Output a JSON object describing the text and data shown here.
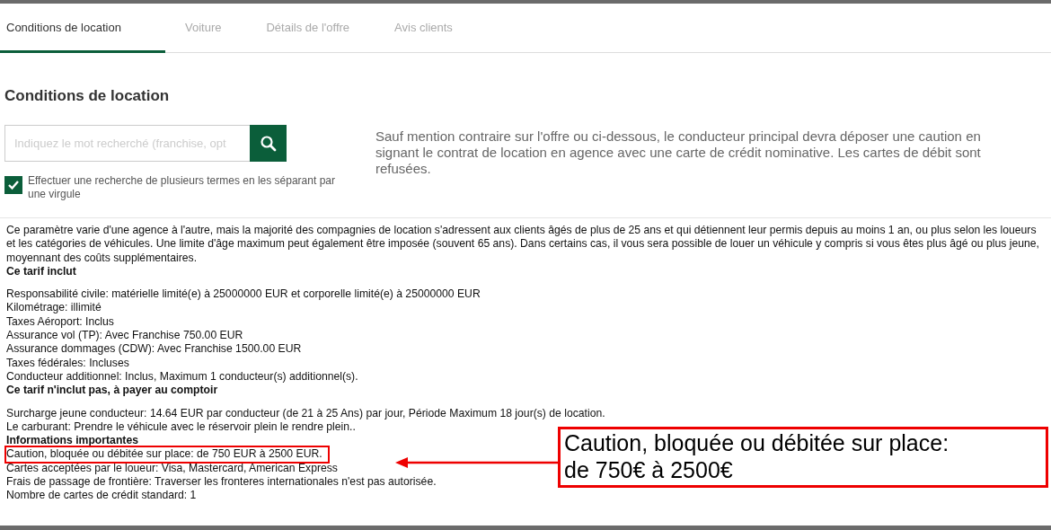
{
  "tabs": [
    {
      "label": "Conditions de location",
      "selected": true
    },
    {
      "label": "Voiture",
      "selected": false
    },
    {
      "label": "Détails de l'offre",
      "selected": false
    },
    {
      "label": "Avis clients",
      "selected": false
    }
  ],
  "heading": "Conditions de location",
  "search": {
    "placeholder": "Indiquez le mot recherché (franchise, opt"
  },
  "multi_term": {
    "label": "Effectuer une recherche de plusieurs termes en les séparant par une virgule",
    "checked": true
  },
  "deposit_notice": "Sauf mention contraire sur l'offre ou ci-dessous, le conducteur principal devra déposer une caution en signant le contrat de location en agence avec une carte de crédit nominative. Les cartes de débit sont refusées.",
  "intro": "Ce paramètre varie d'une agence à l'autre, mais la majorité des compagnies de location s'adressent aux clients âgés de plus de 25 ans et qui détiennent leur permis depuis au moins 1 an, ou plus selon les loueurs et les catégories de véhicules. Une limite d'âge maximum peut également être imposée (souvent 65 ans). Dans certains cas, il vous sera possible de louer un véhicule y compris si vous êtes plus âgé ou plus jeune, moyennant des coûts supplémentaires.",
  "sections": [
    {
      "title": "Ce tarif inclut",
      "spaced": true,
      "lines": [
        {
          "text": "Responsabilité civile: matérielle limité(e) à  25000000 EUR et corporelle limité(e) à  25000000 EUR",
          "highlighted": false
        },
        {
          "text": "Kilométrage: illimité",
          "highlighted": false
        },
        {
          "text": "Taxes Aéroport: Inclus",
          "highlighted": false
        },
        {
          "text": "Assurance vol (TP): Avec Franchise 750.00 EUR",
          "highlighted": false
        },
        {
          "text": "Assurance dommages (CDW): Avec Franchise 1500.00 EUR",
          "highlighted": false
        },
        {
          "text": "Taxes fédérales: Incluses",
          "highlighted": false
        },
        {
          "text": "Conducteur additionnel: Inclus, Maximum 1 conducteur(s) additionnel(s).",
          "highlighted": false
        }
      ]
    },
    {
      "title": "Ce tarif n'inclut pas, à payer au comptoir",
      "spaced": true,
      "lines": [
        {
          "text": "Surcharge jeune conducteur: 14.64 EUR par conducteur (de 21 à 25 Ans) par jour, Période Maximum 18 jour(s) de location.",
          "highlighted": false
        },
        {
          "text": "Le carburant: Prendre le véhicule avec le réservoir plein le rendre plein..",
          "highlighted": false
        }
      ]
    },
    {
      "title": "Informations importantes",
      "spaced": false,
      "lines": [
        {
          "text": "Caution, bloquée ou débitée sur place: de 750 EUR à 2500 EUR.",
          "highlighted": true
        },
        {
          "text": "Cartes acceptées par le loueur: Visa, Mastercard, American Express",
          "highlighted": false
        },
        {
          "text": "Frais de passage de frontière: Traverser les fronteres internationales n'est pas autorisée.",
          "highlighted": false
        },
        {
          "text": "Nombre de cartes de crédit standard: 1",
          "highlighted": false
        }
      ]
    }
  ],
  "callout": {
    "lines": [
      "Caution, bloquée ou débitée sur place:",
      "de 750€ à 2500€"
    ]
  }
}
